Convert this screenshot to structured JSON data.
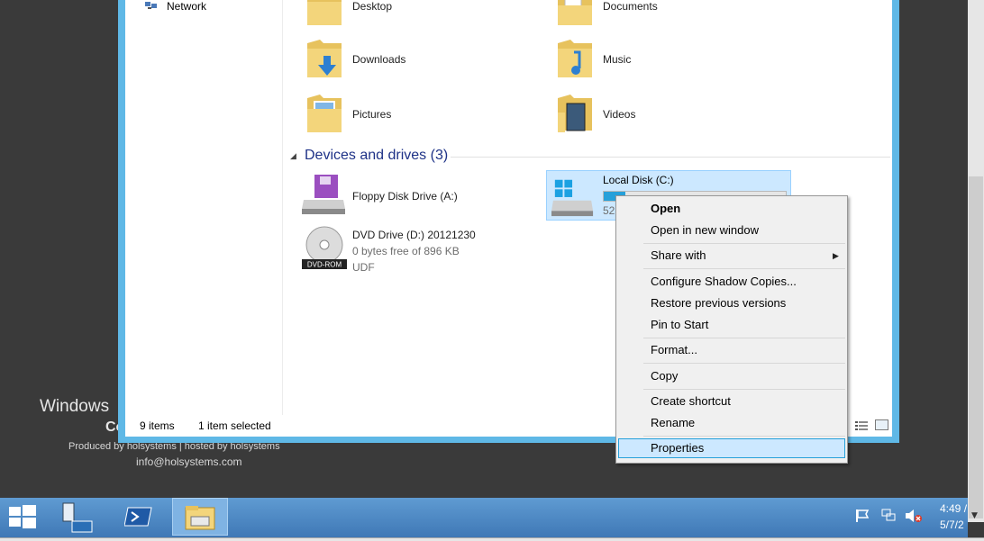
{
  "desktop": {
    "watermark_title": "Windows",
    "watermark_edition": "Co",
    "produced_by": "Produced by holsystems | hosted by holsystems",
    "email": "info@holsystems.com"
  },
  "nav": {
    "items": [
      {
        "label": "Network",
        "icon": "network-icon"
      }
    ]
  },
  "folders": [
    {
      "label": "Desktop",
      "icon": "desktop-folder-icon"
    },
    {
      "label": "Documents",
      "icon": "documents-folder-icon"
    },
    {
      "label": "Downloads",
      "icon": "downloads-folder-icon"
    },
    {
      "label": "Music",
      "icon": "music-folder-icon"
    },
    {
      "label": "Pictures",
      "icon": "pictures-folder-icon"
    },
    {
      "label": "Videos",
      "icon": "videos-folder-icon"
    }
  ],
  "devices_group": {
    "label": "Devices and drives (3)"
  },
  "drives": [
    {
      "label": "Floppy Disk Drive (A:)",
      "icon": "floppy-drive-icon"
    },
    {
      "label": "DVD Drive (D:) 20121230",
      "sub1": "0 bytes free of 896 KB",
      "sub2": "UDF",
      "badge": "DVD-ROM",
      "icon": "dvd-drive-icon"
    },
    {
      "label": "Local Disk (C:)",
      "sub1": "52",
      "usage_fraction": 0.12,
      "icon": "local-disk-icon"
    }
  ],
  "status": {
    "items": "9 items",
    "selected": "1 item selected"
  },
  "context_menu": {
    "open": "Open",
    "open_new_window": "Open in new window",
    "share_with": "Share with",
    "configure_shadow": "Configure Shadow Copies...",
    "restore_versions": "Restore previous versions",
    "pin_to_start": "Pin to Start",
    "format": "Format...",
    "copy": "Copy",
    "create_shortcut": "Create shortcut",
    "rename": "Rename",
    "properties": "Properties"
  },
  "taskbar": {
    "buttons": [
      "start-icon",
      "server-manager-icon",
      "powershell-icon",
      "file-explorer-icon"
    ],
    "tray": [
      "flag-icon",
      "network-tray-icon",
      "volume-muted-icon"
    ],
    "time": "4:49 /",
    "date": "5/7/2"
  },
  "colors": {
    "window_border": "#5fb8e6",
    "selection_fill": "#cce8ff",
    "selection_border": "#99d1ff",
    "group_header": "#1e3287",
    "taskbar": "#4a88c6"
  }
}
